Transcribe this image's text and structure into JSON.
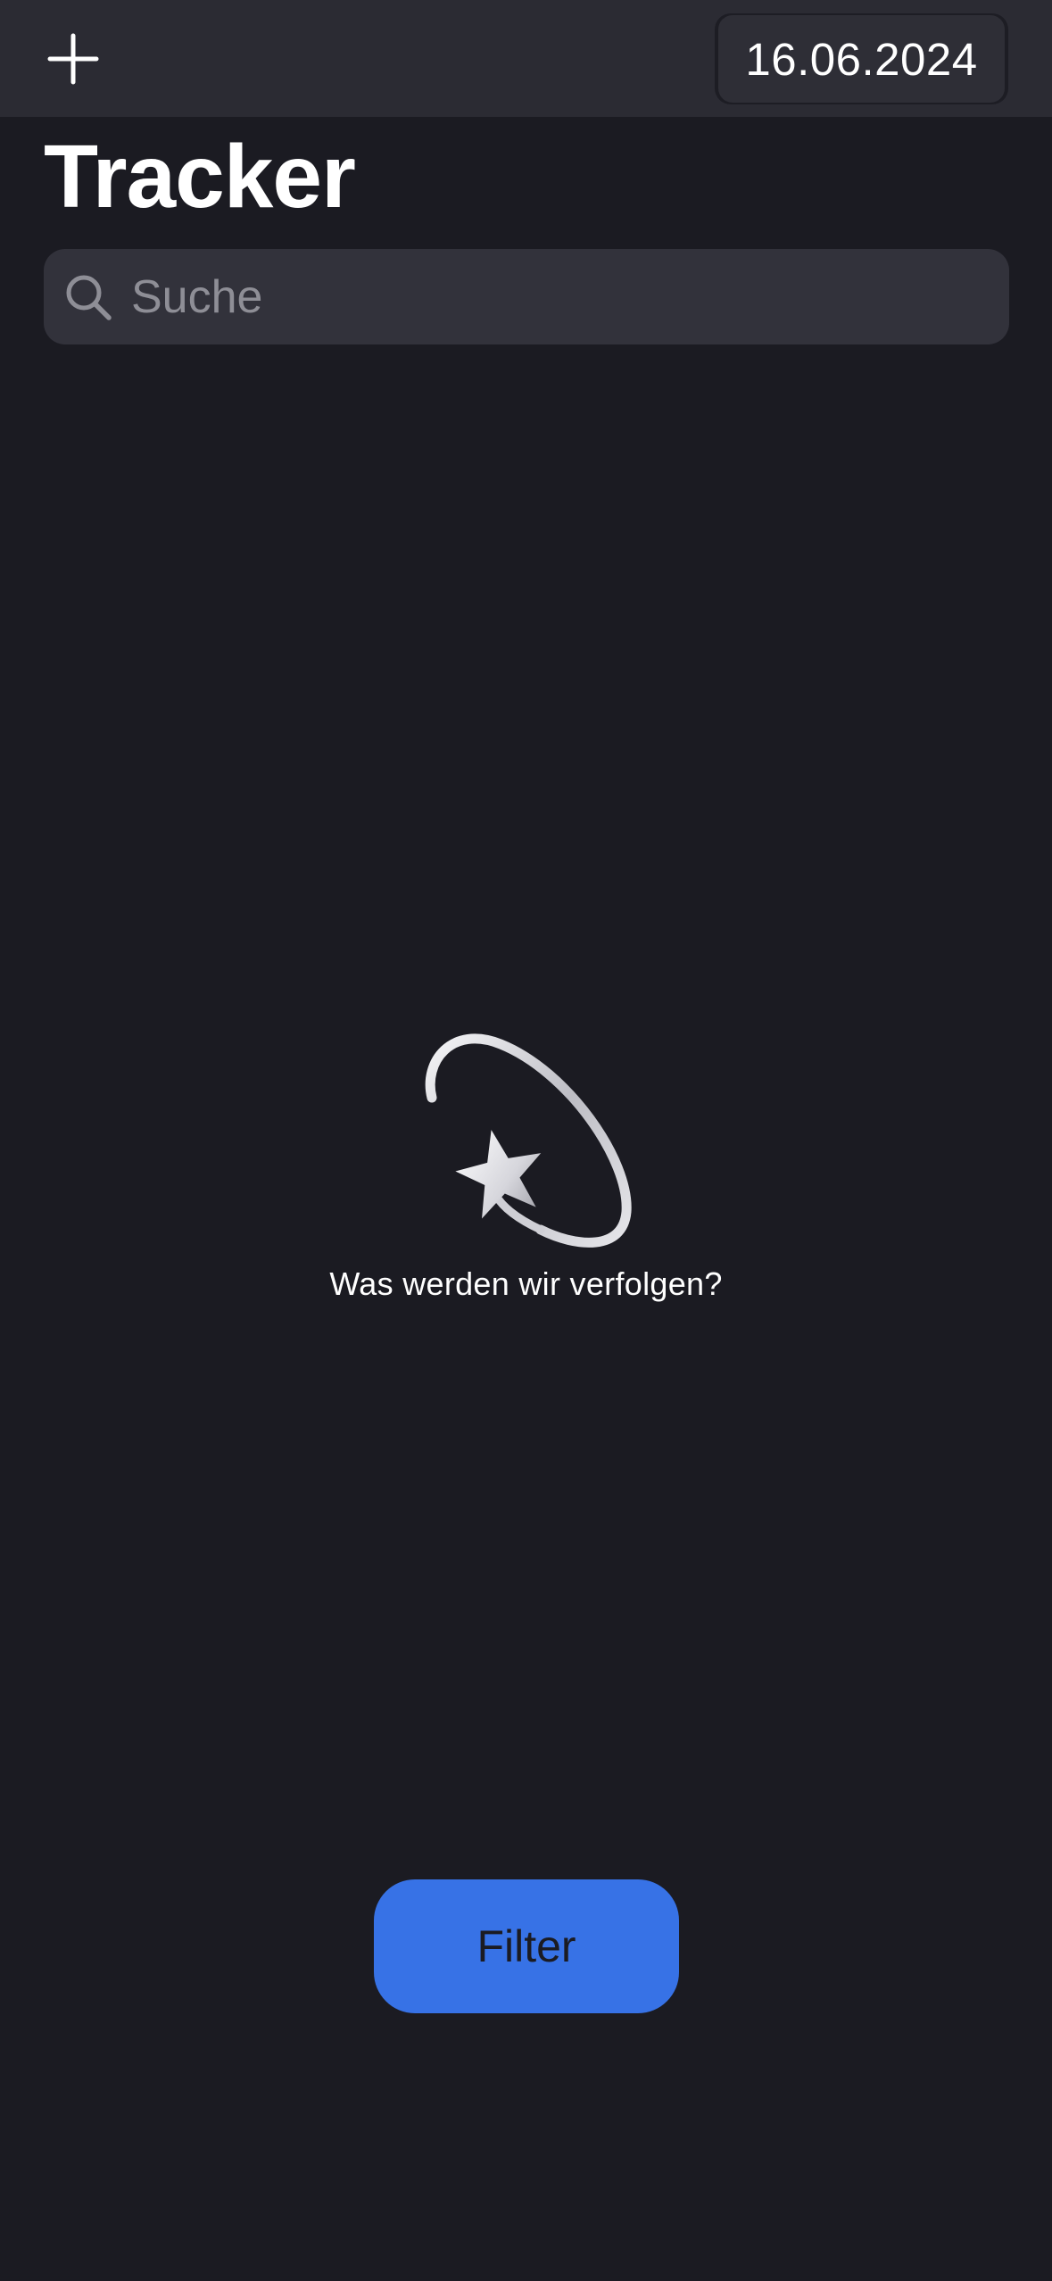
{
  "nav": {
    "add_icon": "plus-icon",
    "date": "16.06.2024"
  },
  "header": {
    "title": "Tracker"
  },
  "search": {
    "icon": "search-icon",
    "placeholder": "Suche"
  },
  "empty_state": {
    "icon": "dizzy-star-icon",
    "message": "Was werden wir verfolgen?"
  },
  "filter": {
    "label": "Filter"
  },
  "colors": {
    "background": "#1b1b22",
    "nav_background": "#2b2b33",
    "search_background": "#32323b",
    "accent": "#3772e6",
    "text": "#ffffff",
    "placeholder": "#8e8e96"
  }
}
